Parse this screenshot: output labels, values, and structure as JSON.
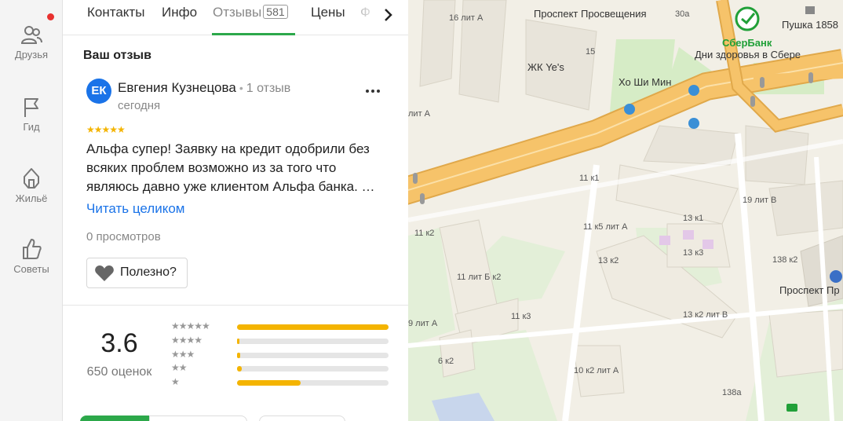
{
  "rail": {
    "items": [
      {
        "label": "Друзья",
        "icon": "friends-icon"
      },
      {
        "label": "Гид",
        "icon": "flag-icon"
      },
      {
        "label": "Жильё",
        "icon": "housing-icon"
      },
      {
        "label": "Советы",
        "icon": "thumbs-up-icon"
      }
    ]
  },
  "tabs": {
    "contacts": "Контакты",
    "info": "Инфо",
    "reviews": "Отзывы",
    "reviews_count": "581",
    "prices": "Цены",
    "partial": "Ф"
  },
  "review": {
    "section_title": "Ваш отзыв",
    "avatar_initials": "ЕК",
    "author": "Евгения Кузнецова",
    "author_reviews": "1 отзыв",
    "date": "сегодня",
    "stars": "★★★★★",
    "rating": 5,
    "text": "Альфа супер! Заявку на кредит одобрили без всяких проблем возможно из за того что являюсь давно уже клиентом Альфа банка. …",
    "read_more": "Читать целиком",
    "views": "0 просмотров",
    "useful_label": "Полезно?"
  },
  "rating_summary": {
    "value": "3.6",
    "count_label": "650 оценок",
    "distribution": [
      {
        "stars": "★★★★★",
        "fraction": 1.0
      },
      {
        "stars": "★★★★",
        "fraction": 0.015
      },
      {
        "stars": "★★★",
        "fraction": 0.02
      },
      {
        "stars": "★★",
        "fraction": 0.03
      },
      {
        "stars": "★",
        "fraction": 0.42
      }
    ]
  },
  "map": {
    "labels": [
      {
        "text": "Проспект Просвещения",
        "big": true
      },
      {
        "text": "16 лит А"
      },
      {
        "text": "30а"
      },
      {
        "text": "Пушка 1858",
        "big": true
      },
      {
        "text": "СберБанк",
        "big": true
      },
      {
        "text": "Дни здоровья в Сбере",
        "big": true
      },
      {
        "text": "15"
      },
      {
        "text": "ЖК Ye's",
        "big": true
      },
      {
        "text": "Хо Ши Мин",
        "big": true
      },
      {
        "text": "лит А"
      },
      {
        "text": "11 к1"
      },
      {
        "text": "19 лит В"
      },
      {
        "text": "13 к1"
      },
      {
        "text": "11 к5 лит А"
      },
      {
        "text": "11 к2"
      },
      {
        "text": "13 к2"
      },
      {
        "text": "13 к3"
      },
      {
        "text": "138 к2"
      },
      {
        "text": "11 лит Б к2"
      },
      {
        "text": "Проспект Пр",
        "big": true
      },
      {
        "text": "11 к3"
      },
      {
        "text": "13 к2 лит В"
      },
      {
        "text": "9 лит А"
      },
      {
        "text": "6 к2"
      },
      {
        "text": "10 к2 лит А"
      },
      {
        "text": "138а"
      }
    ],
    "colors": {
      "road": "#f6c36a",
      "road_edge": "#e0a84a",
      "park": "#d6ecc6",
      "building": "#e8e4da",
      "block": "#f2efe6",
      "sber_green": "#21a038"
    }
  }
}
